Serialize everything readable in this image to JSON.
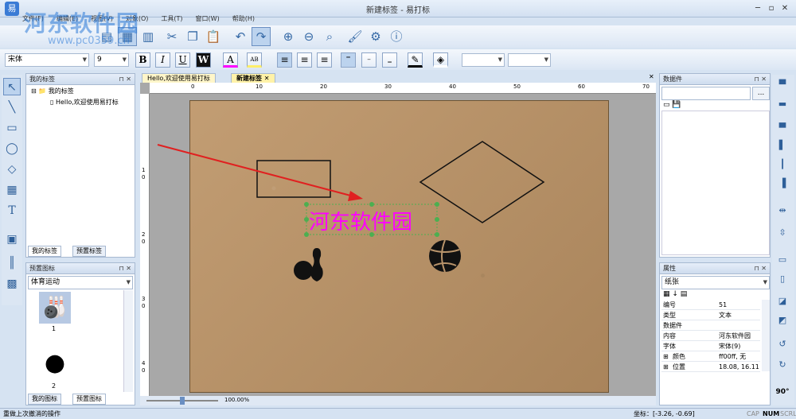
{
  "window": {
    "title": "新建标签 - 易打标",
    "watermark": "河东软件园",
    "watermark_url": "www.pc0359.cn"
  },
  "menu": [
    "文件(F)",
    "编辑(E)",
    "视图(V)",
    "对象(O)",
    "工具(T)",
    "窗口(W)",
    "帮助(H)"
  ],
  "format": {
    "font": "宋体",
    "size": "9",
    "bold": "B",
    "italic": "I",
    "underline": "U",
    "wordart": "W",
    "color_letter": "A",
    "bg_letters": "AB"
  },
  "left_panel": {
    "title": "我的标签",
    "tree_root": "我的标签",
    "tree_child": "Hello,欢迎使用易打标",
    "tabs": [
      "我的标签",
      "预置标签"
    ]
  },
  "icon_panel": {
    "title": "预置图标",
    "category": "体育运动",
    "items": [
      "1",
      "2"
    ],
    "tabs": [
      "我的图标",
      "预置图标"
    ]
  },
  "doc_tabs": [
    "Hello,欢迎使用易打标",
    "新建标签"
  ],
  "ruler": {
    "top": [
      "0",
      "10",
      "20",
      "30",
      "40",
      "50",
      "60",
      "70"
    ],
    "left": [
      "1",
      "0",
      "2",
      "0",
      "3",
      "0",
      "4",
      "0"
    ]
  },
  "canvas": {
    "text": "河东软件园",
    "zoom": "100.00%"
  },
  "data_panel": {
    "title": "数据件"
  },
  "props": {
    "title": "属性",
    "selector": "纸张",
    "rows": [
      [
        "编号",
        "51"
      ],
      [
        "类型",
        "文本"
      ],
      [
        "数据件",
        ""
      ],
      [
        "内容",
        "河东软件园"
      ],
      [
        "字体",
        "宋体(9)"
      ],
      [
        "颜色",
        "ff00ff, 无"
      ],
      [
        "位置",
        "18.08, 16.11"
      ]
    ]
  },
  "status": {
    "left": "重做上次撤消的操作",
    "coords": "坐标：[-3.26, -0.69]",
    "cap": "CAP",
    "num": "NUM",
    "scrl": "SCRL"
  },
  "rotate_label": "90°",
  "colors": {
    "accent": "#ff00ff",
    "arrow": "#e02020"
  }
}
